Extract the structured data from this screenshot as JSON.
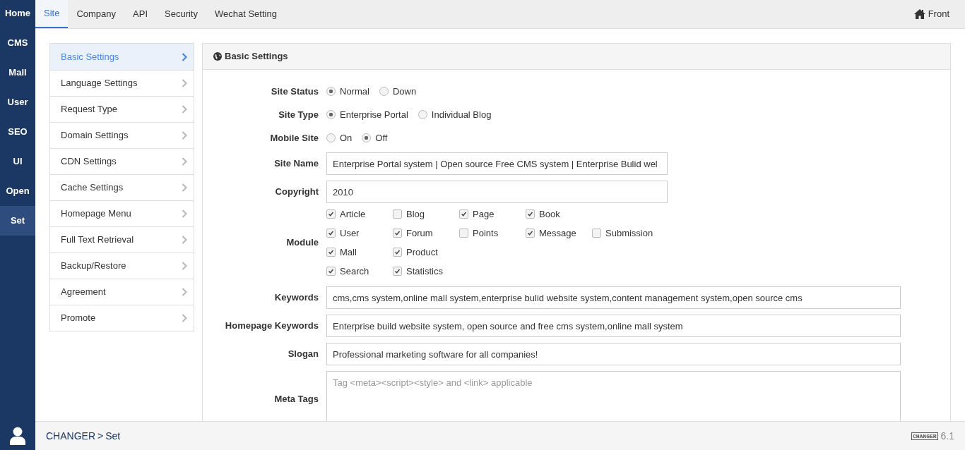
{
  "rail": [
    {
      "label": "Home",
      "selected": false
    },
    {
      "label": "CMS",
      "selected": false
    },
    {
      "label": "Mall",
      "selected": false
    },
    {
      "label": "User",
      "selected": false
    },
    {
      "label": "SEO",
      "selected": false
    },
    {
      "label": "UI",
      "selected": false
    },
    {
      "label": "Open",
      "selected": false
    },
    {
      "label": "Set",
      "selected": true
    }
  ],
  "top_tabs": [
    {
      "label": "Site",
      "selected": true
    },
    {
      "label": "Company",
      "selected": false
    },
    {
      "label": "API",
      "selected": false
    },
    {
      "label": "Security",
      "selected": false
    },
    {
      "label": "Wechat Setting",
      "selected": false
    }
  ],
  "front_link": "Front",
  "side_menu": [
    {
      "label": "Basic Settings",
      "selected": true
    },
    {
      "label": "Language Settings",
      "selected": false
    },
    {
      "label": "Request Type",
      "selected": false
    },
    {
      "label": "Domain Settings",
      "selected": false
    },
    {
      "label": "CDN Settings",
      "selected": false
    },
    {
      "label": "Cache Settings",
      "selected": false
    },
    {
      "label": "Homepage Menu",
      "selected": false
    },
    {
      "label": "Full Text Retrieval",
      "selected": false
    },
    {
      "label": "Backup/Restore",
      "selected": false
    },
    {
      "label": "Agreement",
      "selected": false
    },
    {
      "label": "Promote",
      "selected": false
    }
  ],
  "panel": {
    "title": "Basic Settings",
    "fields": [
      {
        "kind": "radio",
        "label": "Site Status",
        "options": [
          {
            "label": "Normal",
            "selected": true
          },
          {
            "label": "Down",
            "selected": false
          }
        ]
      },
      {
        "kind": "radio",
        "label": "Site Type",
        "options": [
          {
            "label": "Enterprise Portal",
            "selected": true
          },
          {
            "label": "Individual Blog",
            "selected": false
          }
        ]
      },
      {
        "kind": "radio",
        "label": "Mobile Site",
        "options": [
          {
            "label": "On",
            "selected": false
          },
          {
            "label": "Off",
            "selected": true
          }
        ]
      },
      {
        "kind": "text",
        "label": "Site Name",
        "value": "Enterprise Portal system | Open source Free CMS system | Enterprise Bulid wel",
        "wide": false
      },
      {
        "kind": "text",
        "label": "Copyright",
        "value": "2010",
        "wide": false
      },
      {
        "kind": "checkboxes",
        "label": "Module",
        "rows": [
          [
            {
              "label": "Article",
              "checked": true
            },
            {
              "label": "Blog",
              "checked": false
            },
            {
              "label": "Page",
              "checked": true
            },
            {
              "label": "Book",
              "checked": true
            }
          ],
          [
            {
              "label": "User",
              "checked": true
            },
            {
              "label": "Forum",
              "checked": true
            },
            {
              "label": "Points",
              "checked": false
            },
            {
              "label": "Message",
              "checked": true
            },
            {
              "label": "Submission",
              "checked": false
            }
          ],
          [
            {
              "label": "Mall",
              "checked": true
            },
            {
              "label": "Product",
              "checked": true
            }
          ],
          [
            {
              "label": "Search",
              "checked": true
            },
            {
              "label": "Statistics",
              "checked": true
            }
          ]
        ]
      },
      {
        "kind": "text",
        "label": "Keywords",
        "value": "cms,cms system,online mall system,enterprise bulid website system,content management system,open source cms",
        "wide": true
      },
      {
        "kind": "text",
        "label": "Homepage Keywords",
        "value": "Enterprise build website system, open source and free cms system,online mall system",
        "wide": true
      },
      {
        "kind": "text",
        "label": "Slogan",
        "value": "Professional marketing software for all companies!",
        "wide": true
      },
      {
        "kind": "textarea",
        "label": "Meta Tags",
        "placeholder": "Tag <meta><script><style> and <link> applicable"
      }
    ]
  },
  "footer": {
    "breadcrumb": [
      "CHANGER",
      "Set"
    ],
    "separator": ">",
    "logo": "CHANGER",
    "version": "6.1"
  }
}
